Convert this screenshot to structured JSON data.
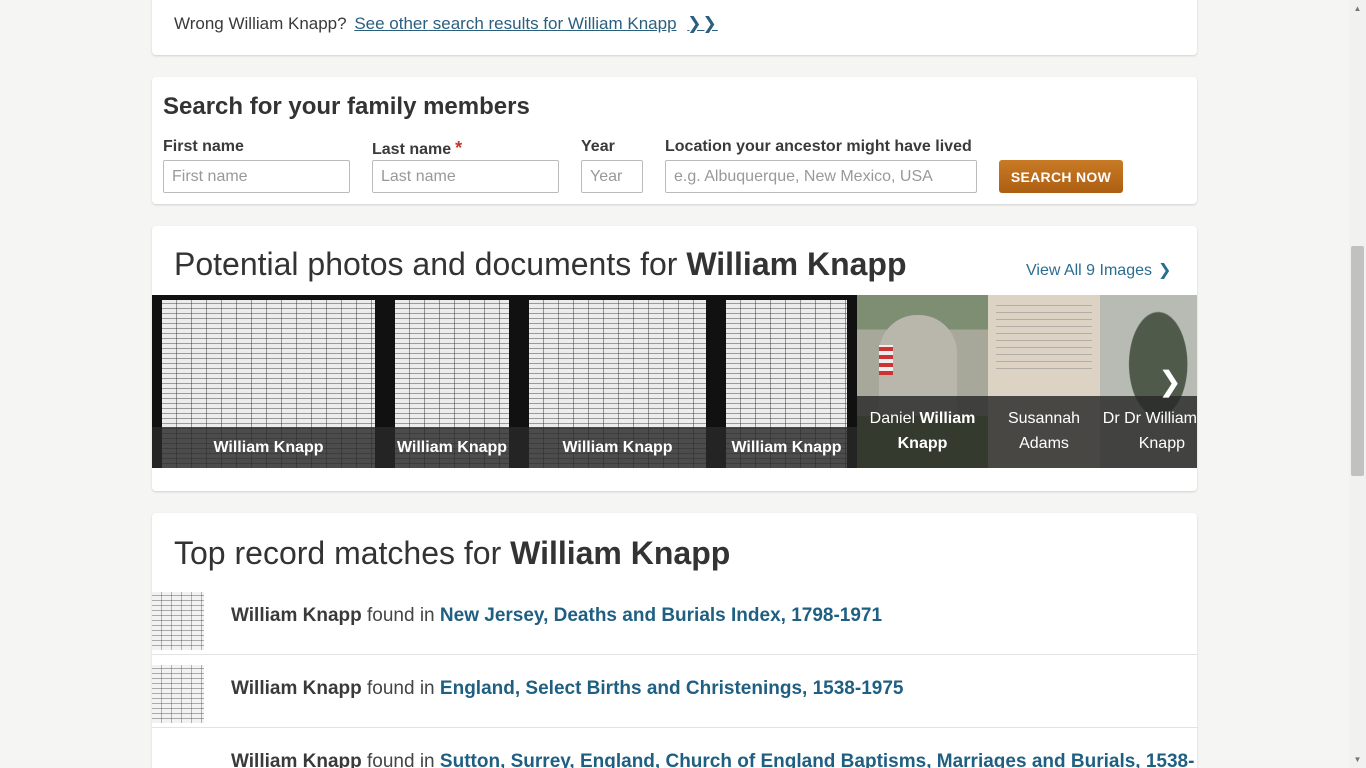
{
  "wrong": {
    "question": "Wrong William Knapp?",
    "link": "See other search results for William Knapp",
    "chevrons": "❯❯"
  },
  "search": {
    "title": "Search for your family members",
    "first_label": "First name",
    "first_placeholder": "First name",
    "last_label": "Last name",
    "last_placeholder": "Last name",
    "required_mark": "*",
    "year_label": "Year",
    "year_placeholder": "Year",
    "location_label": "Location your ancestor might have lived",
    "location_placeholder": "e.g. Albuquerque, New Mexico, USA",
    "button": "SEARCH NOW"
  },
  "photos": {
    "title_prefix": "Potential photos and documents for",
    "title_name": "William Knapp",
    "view_all": "View All 9 Images",
    "chevron": "❯",
    "next": "❯",
    "items": [
      {
        "caption": "William Knapp"
      },
      {
        "caption": "William Knapp"
      },
      {
        "caption": "William Knapp"
      },
      {
        "caption": "William Knapp"
      },
      {
        "caption_pre": "Daniel",
        "caption_bold": "William",
        "caption_line2": "Knapp"
      },
      {
        "caption_line1": "Susannah",
        "caption_line2": "Adams"
      },
      {
        "caption_line1": "Dr Dr William",
        "caption_line2": "Knapp"
      }
    ]
  },
  "records": {
    "title_prefix": "Top record matches for",
    "title_name": "William Knapp",
    "found_in": "found in",
    "rows": [
      {
        "name": "William Knapp",
        "collection": "New Jersey, Deaths and Burials Index, 1798-1971"
      },
      {
        "name": "William Knapp",
        "collection": "England, Select Births and Christenings, 1538-1975"
      },
      {
        "name": "William Knapp",
        "collection": "Sutton, Surrey, England, Church of England Baptisms, Marriages and Burials, 1538-"
      }
    ]
  }
}
